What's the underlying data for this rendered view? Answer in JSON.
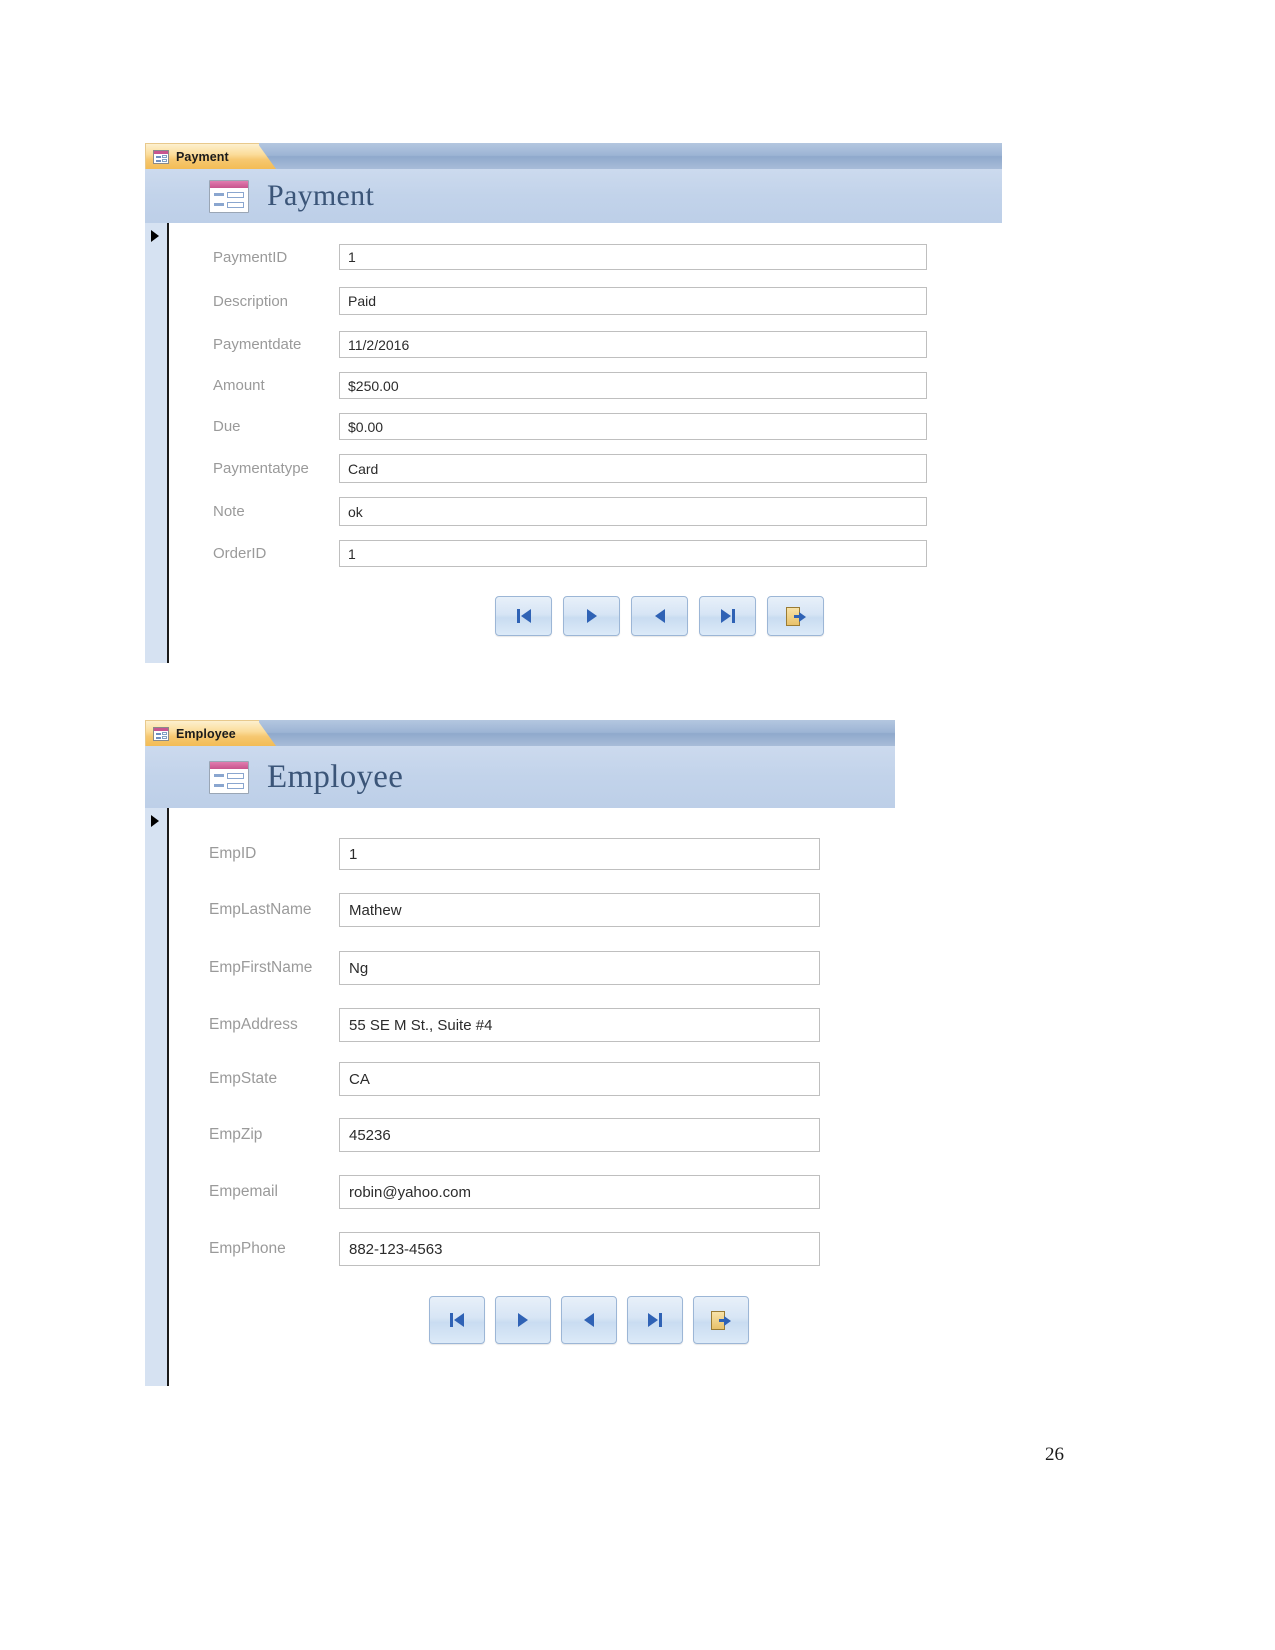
{
  "page": {
    "number": "26"
  },
  "forms": [
    {
      "id": "payment",
      "tab_label": "Payment",
      "title": "Payment",
      "tab_icon": "form-icon",
      "header_icon": "form-icon",
      "fields": [
        {
          "label": "PaymentID",
          "value": "1"
        },
        {
          "label": "Description",
          "value": "Paid"
        },
        {
          "label": "Paymentdate",
          "value": "11/2/2016"
        },
        {
          "label": "Amount",
          "value": "$250.00"
        },
        {
          "label": "Due",
          "value": "$0.00"
        },
        {
          "label": "Paymentatype",
          "value": "Card"
        },
        {
          "label": "Note",
          "value": "ok"
        },
        {
          "label": "OrderID",
          "value": "1"
        }
      ],
      "nav_buttons": [
        {
          "name": "first-record-button",
          "icon": "first-record-icon"
        },
        {
          "name": "next-record-button",
          "icon": "next-record-icon"
        },
        {
          "name": "previous-record-button",
          "icon": "previous-record-icon"
        },
        {
          "name": "last-record-button",
          "icon": "last-record-icon"
        },
        {
          "name": "exit-form-button",
          "icon": "exit-door-icon"
        }
      ]
    },
    {
      "id": "employee",
      "tab_label": "Employee",
      "title": "Employee",
      "tab_icon": "form-icon",
      "header_icon": "form-icon",
      "fields": [
        {
          "label": "EmpID",
          "value": "1"
        },
        {
          "label": "EmpLastName",
          "value": "Mathew"
        },
        {
          "label": "EmpFirstName",
          "value": "Ng"
        },
        {
          "label": "EmpAddress",
          "value": "55 SE M St., Suite #4"
        },
        {
          "label": "EmpState",
          "value": "CA"
        },
        {
          "label": "EmpZip",
          "value": "45236"
        },
        {
          "label": "Empemail",
          "value": "robin@yahoo.com"
        },
        {
          "label": "EmpPhone",
          "value": "882-123-4563"
        }
      ],
      "nav_buttons": [
        {
          "name": "first-record-button",
          "icon": "first-record-icon"
        },
        {
          "name": "next-record-button",
          "icon": "next-record-icon"
        },
        {
          "name": "previous-record-button",
          "icon": "previous-record-icon"
        },
        {
          "name": "last-record-button",
          "icon": "last-record-icon"
        },
        {
          "name": "exit-form-button",
          "icon": "exit-door-icon"
        }
      ]
    }
  ],
  "colors": {
    "tab_accent": "#f3bc55",
    "header_band": "#c2d3ea",
    "title_text": "#3b5578",
    "label_text": "#9a9a9a",
    "nav_glyph": "#2f62b5"
  }
}
